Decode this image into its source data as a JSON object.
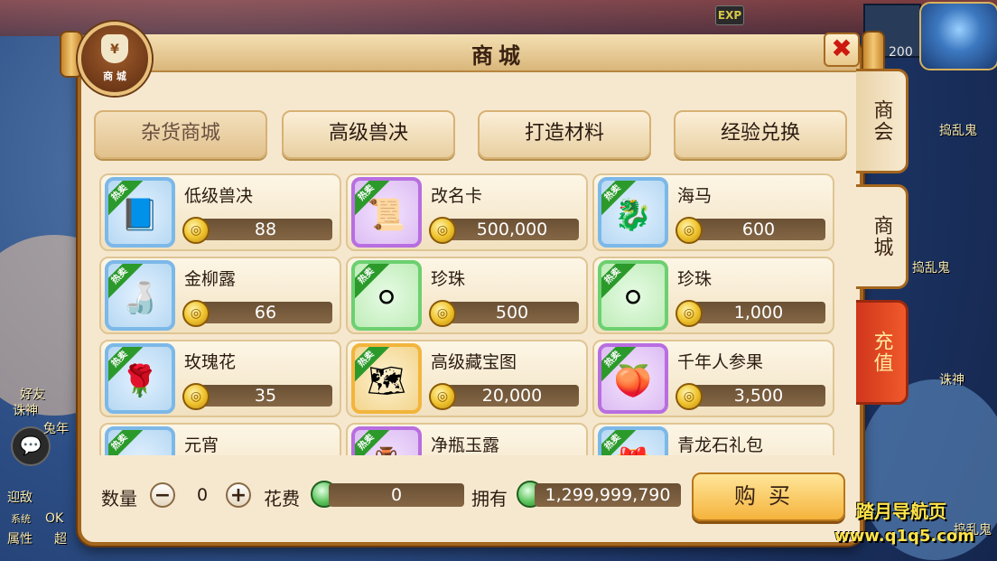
{
  "window": {
    "title": "商城"
  },
  "hud": {
    "exp_label": "EXP",
    "hp_value": "200",
    "chat_icon": "chat-icon",
    "side_texts": [
      "捣乱鬼",
      "捣乱鬼",
      "诛神",
      "捣乱鬼",
      "好友",
      "诛神",
      "兔年",
      "迎敌",
      "系统",
      "OK",
      "属性",
      "超"
    ]
  },
  "shop_badge": {
    "symbol": "¥",
    "label": "商 城"
  },
  "close": {
    "symbol": "✖"
  },
  "side_tabs": {
    "guild": "商会",
    "shop": "商城",
    "recharge": "充值"
  },
  "categories": [
    "杂货商城",
    "高级兽决",
    "打造材料",
    "经验兑换"
  ],
  "hot_label": "热卖",
  "items": [
    {
      "name": "低级兽决",
      "price": "88",
      "frame": "blue",
      "icon": "book-icon",
      "glyph": "📘"
    },
    {
      "name": "改名卡",
      "price": "500,000",
      "frame": "purple",
      "icon": "scroll-icon",
      "glyph": "📜"
    },
    {
      "name": "海马",
      "price": "600",
      "frame": "blue",
      "icon": "seahorse-icon",
      "glyph": "🐉"
    },
    {
      "name": "金柳露",
      "price": "66",
      "frame": "blue",
      "icon": "elixir-icon",
      "glyph": "🍶"
    },
    {
      "name": "珍珠",
      "price": "500",
      "frame": "green",
      "icon": "pearl-icon",
      "glyph": "⚪"
    },
    {
      "name": "珍珠",
      "price": "1,000",
      "frame": "green",
      "icon": "pearl-icon",
      "glyph": "⚪"
    },
    {
      "name": "玫瑰花",
      "price": "35",
      "frame": "blue",
      "icon": "rose-icon",
      "glyph": "🌹"
    },
    {
      "name": "高级藏宝图",
      "price": "20,000",
      "frame": "gold",
      "icon": "treasure-map-icon",
      "glyph": "🗺"
    },
    {
      "name": "千年人参果",
      "price": "3,500",
      "frame": "purple",
      "icon": "ginseng-fruit-icon",
      "glyph": "🍑"
    },
    {
      "name": "元宵",
      "price": "",
      "frame": "blue",
      "icon": "dumpling-icon",
      "glyph": "⚪"
    },
    {
      "name": "净瓶玉露",
      "price": "",
      "frame": "purple",
      "icon": "vase-icon",
      "glyph": "🏺"
    },
    {
      "name": "青龙石礼包",
      "price": "",
      "frame": "blue",
      "icon": "gift-pack-icon",
      "glyph": "🎁"
    }
  ],
  "footer": {
    "qty_label": "数量",
    "qty_value": "0",
    "minus": "−",
    "plus": "+",
    "cost_label": "花费",
    "cost_value": "0",
    "own_label": "拥有",
    "own_value": "1,299,999,790",
    "buy_label": "购买"
  },
  "watermark": {
    "line1": "踏月导航页",
    "line2": "www.q1q5.com"
  }
}
